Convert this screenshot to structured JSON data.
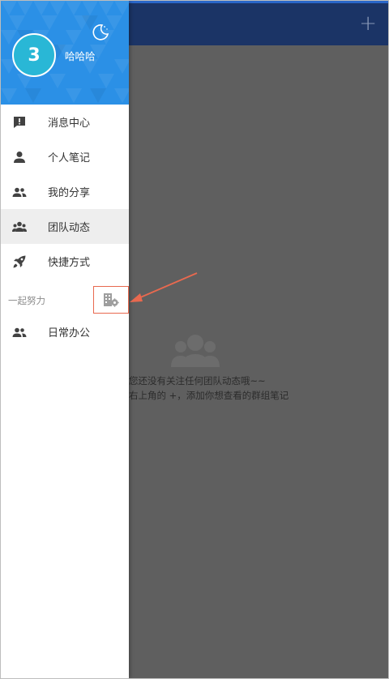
{
  "header": {
    "add_label": "+"
  },
  "drawer": {
    "user": {
      "avatar_text": "3",
      "name": "哈哈哈"
    },
    "menu": [
      {
        "label": "消息中心",
        "icon": "message-alert-icon"
      },
      {
        "label": "个人笔记",
        "icon": "person-icon"
      },
      {
        "label": "我的分享",
        "icon": "people-icon"
      },
      {
        "label": "团队动态",
        "icon": "group-icon",
        "active": true
      },
      {
        "label": "快捷方式",
        "icon": "rocket-icon"
      }
    ],
    "group": {
      "title": "一起努力",
      "settings_icon": "building-gear-icon"
    },
    "group_items": [
      {
        "label": "日常办公",
        "icon": "people-icon"
      }
    ]
  },
  "empty_state": {
    "line1": "您还没有关注任何团队动态哦~~",
    "line2": "右上角的 +，添加你想查看的群组笔记"
  },
  "colors": {
    "header_bg": "#1b3466",
    "drawer_header": "#2b90e6",
    "avatar": "#29b7d6",
    "annotation": "#e8694f"
  }
}
